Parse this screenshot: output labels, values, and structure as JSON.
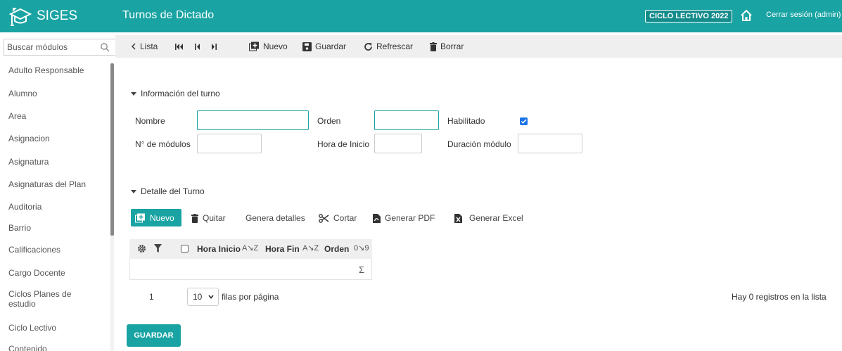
{
  "header": {
    "brand": "SIGES",
    "title": "Turnos de Dictado",
    "ciclo_badge": "CICLO LECTIVO 2022",
    "logout": "Cerrar sesión (admin)"
  },
  "sidebar": {
    "search_placeholder": "Buscar módulos",
    "items": [
      "Adulto Responsable",
      "Alumno",
      "Area",
      "Asignacion",
      "Asignatura",
      "Asignaturas del Plan",
      "Auditoria",
      "Barrio",
      "Calificaciones",
      "Cargo Docente",
      "Ciclos Planes de estudio",
      "Ciclo Lectivo",
      "Contenido"
    ]
  },
  "toolbar": {
    "lista": "Lista",
    "nuevo": "Nuevo",
    "guardar": "Guardar",
    "refrescar": "Refrescar",
    "borrar": "Borrar"
  },
  "info_section": {
    "title": "Información del turno",
    "nombre_label": "Nombre",
    "nombre_value": "",
    "orden_label": "Orden",
    "orden_value": "",
    "habilitado_label": "Habilitado",
    "habilitado_checked": true,
    "modulos_label": "N° de módulos",
    "modulos_value": "",
    "hora_inicio_label": "Hora de Inicio",
    "hora_inicio_value": "",
    "duracion_label": "Duración módulo",
    "duracion_value": ""
  },
  "detail_section": {
    "title": "Detalle del Turno",
    "nuevo": "Nuevo",
    "quitar": "Quitar",
    "genera_detalles": "Genera detalles",
    "cortar": "Cortar",
    "generar_pdf": "Generar PDF",
    "generar_excel": "Generar Excel",
    "columns": [
      "Hora Inicio",
      "Hora Fin",
      "Orden"
    ],
    "sigma": "Σ"
  },
  "pager": {
    "page": "1",
    "page_size": "10",
    "rows_per_page": "filas por página",
    "record_count": "Hay 0 registros en la lista"
  },
  "save_button": "GUARDAR",
  "colors": {
    "accent": "#1aa3a3",
    "checkbox": "#1a73e8"
  }
}
